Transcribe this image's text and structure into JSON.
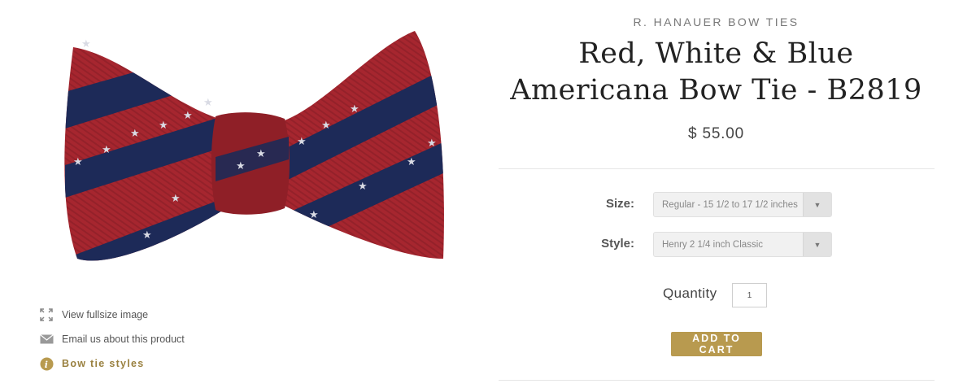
{
  "product": {
    "brand": "R. HANAUER BOW TIES",
    "title": "Red, White & Blue Americana Bow Tie - B2819",
    "price": "$ 55.00",
    "image_alt": "Red, White & Blue Americana bow tie",
    "colors": {
      "red": "#a6262f",
      "navy": "#1d2a58",
      "star": "#d9dbe4",
      "accent": "#b89a4f"
    }
  },
  "links": {
    "fullsize": "View fullsize image",
    "email": "Email us about this product",
    "styles": "Bow tie styles"
  },
  "options": {
    "size_label": "Size:",
    "size_value": "Regular - 15 1/2 to 17 1/2 inches",
    "style_label": "Style:",
    "style_value": "Henry 2 1/4 inch Classic"
  },
  "cart": {
    "quantity_label": "Quantity",
    "quantity_value": "1",
    "add_label": "ADD TO CART"
  }
}
